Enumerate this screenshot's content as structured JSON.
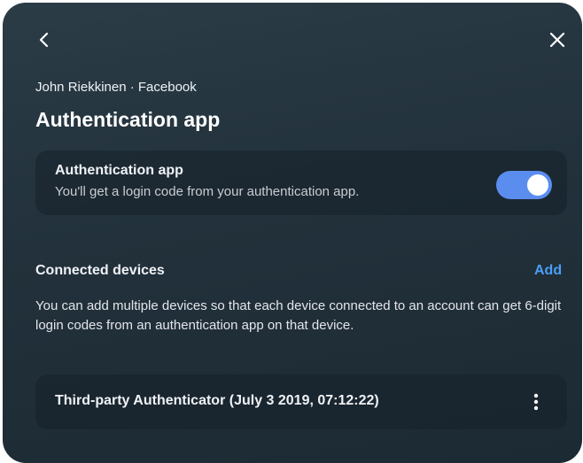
{
  "nav": {
    "back_icon": "chevron-left-icon",
    "close_icon": "close-icon"
  },
  "header": {
    "account_line": "John Riekkinen · Facebook",
    "title": "Authentication app"
  },
  "auth_setting": {
    "title": "Authentication app",
    "description": "You'll get a login code from your authentication app.",
    "enabled": true,
    "toggle_color": "#5b8def"
  },
  "connected_devices": {
    "title": "Connected devices",
    "add_label": "Add",
    "add_color": "#4a9ff5",
    "description": "You can add multiple devices so that each device connected to an account can get 6-digit login codes from an authentication app on that device.",
    "devices": [
      {
        "name": "Third-party Authenticator (July 3 2019, 07:12:22)",
        "menu_icon": "more-vertical-icon"
      }
    ]
  }
}
